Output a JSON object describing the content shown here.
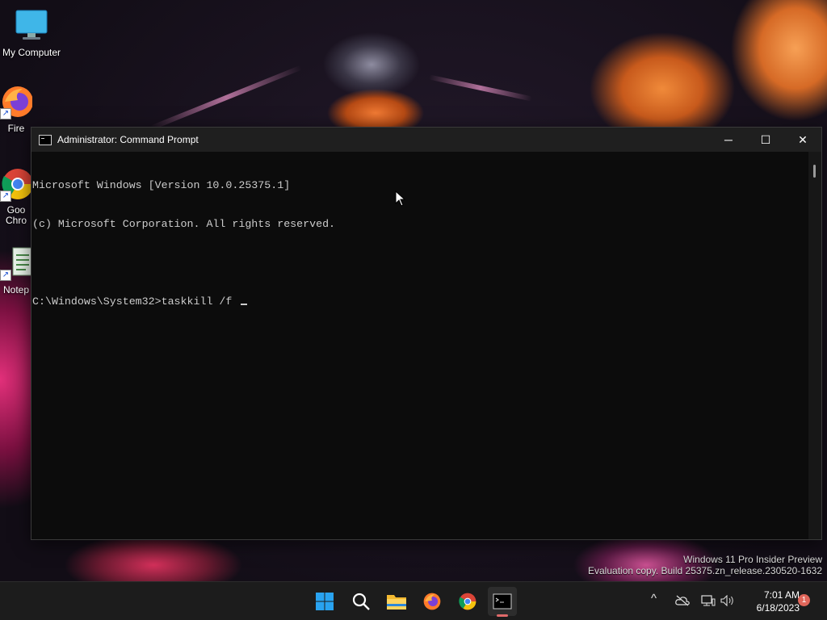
{
  "desktop": {
    "icons": [
      {
        "label": "My Computer"
      },
      {
        "label": "Fire"
      },
      {
        "label": "Goo Chro"
      },
      {
        "label": "Notep"
      }
    ]
  },
  "window": {
    "title": "Administrator: Command Prompt",
    "controls": {
      "minimize": "─",
      "maximize": "☐",
      "close": "✕"
    }
  },
  "console": {
    "lines": [
      "Microsoft Windows [Version 10.0.25375.1]",
      "(c) Microsoft Corporation. All rights reserved.",
      "",
      "C:\\Windows\\System32>taskkill /f "
    ]
  },
  "watermark": {
    "line1": "Windows 11 Pro Insider Preview",
    "line2": "Evaluation copy. Build 25375.zn_release.230520-1632"
  },
  "taskbar": {
    "apps": [
      "start-icon",
      "search-icon",
      "file-explorer-icon",
      "firefox-icon",
      "chrome-icon",
      "command-prompt-icon"
    ],
    "tray": {
      "overflow": "^",
      "time": "7:01 AM",
      "date": "6/18/2023",
      "notification_count": "1"
    }
  },
  "colors": {
    "console_bg": "#0c0c0c",
    "console_text": "#cccccc",
    "titlebar_bg": "#1f1f1f",
    "taskbar_bg": "#1c1c1c",
    "badge": "#e0665a"
  }
}
